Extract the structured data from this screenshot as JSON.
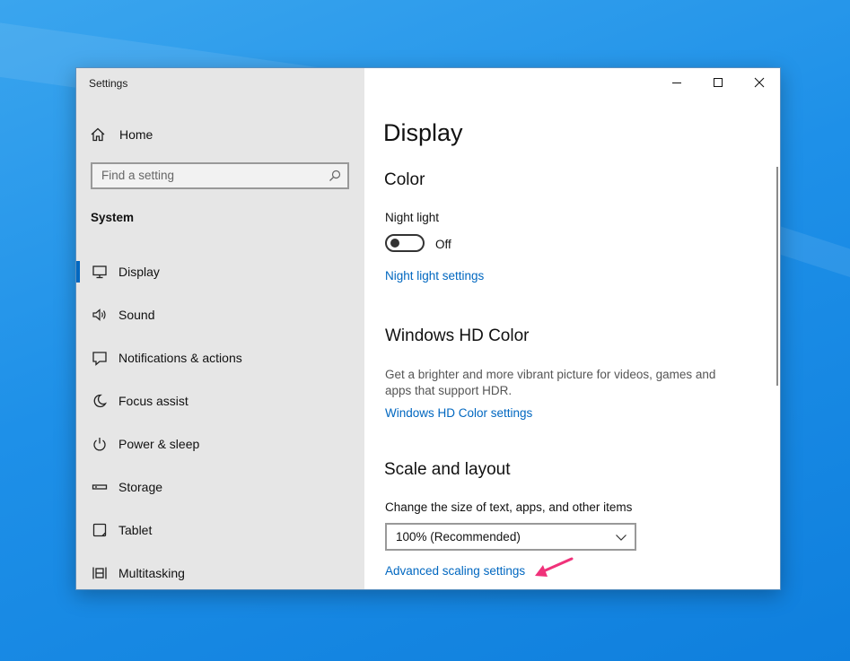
{
  "window": {
    "app_title": "Settings"
  },
  "sidebar": {
    "home_label": "Home",
    "search_placeholder": "Find a setting",
    "section_label": "System",
    "items": [
      {
        "label": "Display",
        "icon": "monitor-icon",
        "selected": true
      },
      {
        "label": "Sound",
        "icon": "speaker-icon",
        "selected": false
      },
      {
        "label": "Notifications & actions",
        "icon": "notification-icon",
        "selected": false
      },
      {
        "label": "Focus assist",
        "icon": "moon-icon",
        "selected": false
      },
      {
        "label": "Power & sleep",
        "icon": "power-icon",
        "selected": false
      },
      {
        "label": "Storage",
        "icon": "storage-icon",
        "selected": false
      },
      {
        "label": "Tablet",
        "icon": "tablet-icon",
        "selected": false
      },
      {
        "label": "Multitasking",
        "icon": "multitasking-icon",
        "selected": false
      }
    ]
  },
  "content": {
    "page_title": "Display",
    "color_section": {
      "heading": "Color",
      "night_light_label": "Night light",
      "toggle_state": "Off",
      "night_light_link": "Night light settings"
    },
    "hd_color_section": {
      "heading": "Windows HD Color",
      "description": "Get a brighter and more vibrant picture for videos, games and apps that support HDR.",
      "link": "Windows HD Color settings"
    },
    "scale_section": {
      "heading": "Scale and layout",
      "change_size_label": "Change the size of text, apps, and other items",
      "scale_value": "100% (Recommended)",
      "advanced_link": "Advanced scaling settings"
    }
  },
  "colors": {
    "accent": "#0067c0",
    "annotation_arrow": "#f0327a",
    "desktop": "#1e90e8"
  }
}
